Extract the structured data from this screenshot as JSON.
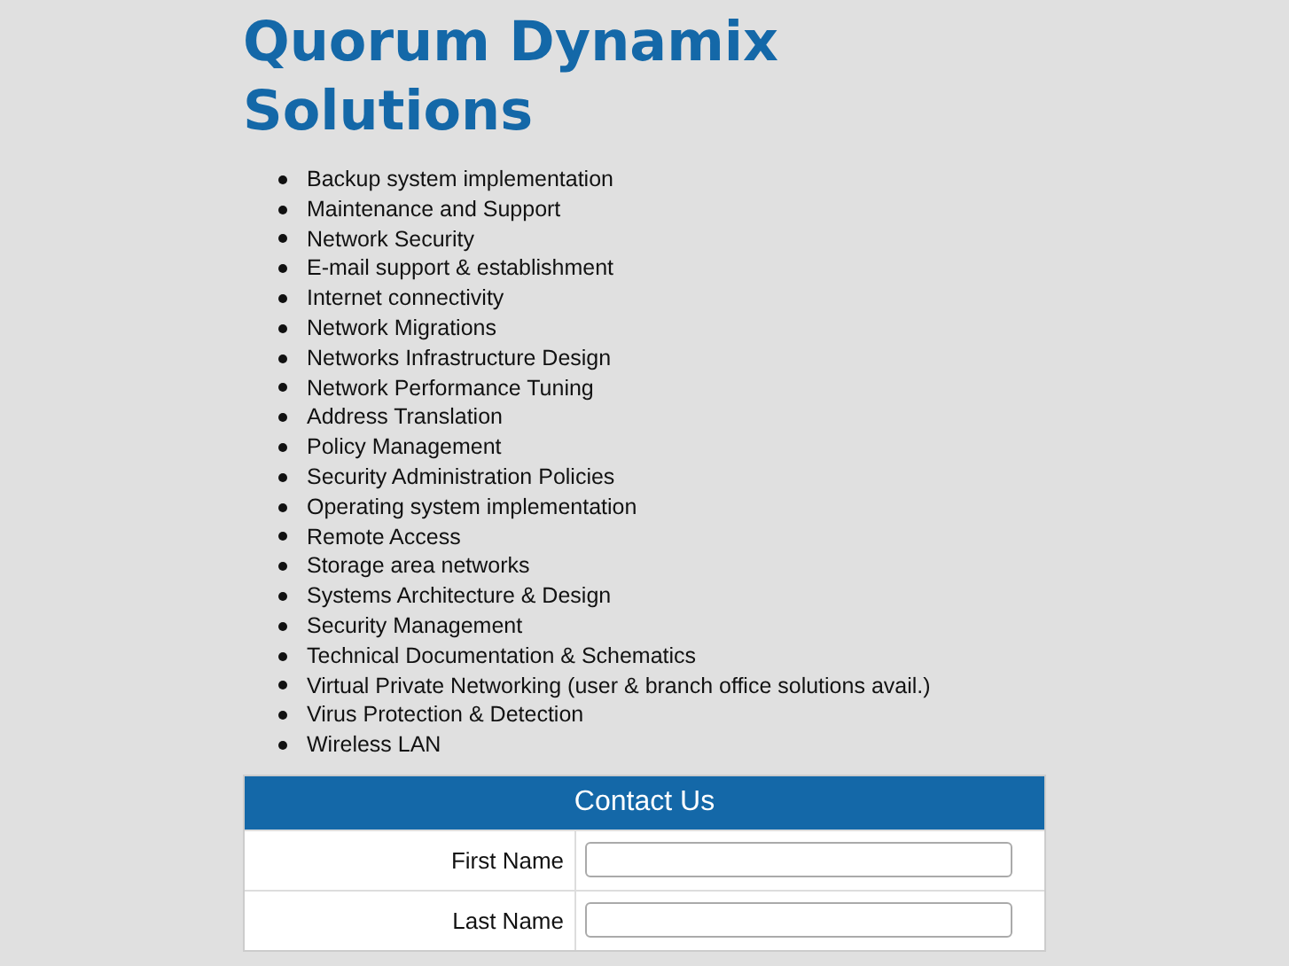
{
  "title": "Quorum Dynamix Solutions",
  "services": [
    "Backup system implementation",
    "Maintenance and Support",
    "Network Security",
    "E-mail support & establishment",
    "Internet connectivity",
    "Network Migrations",
    "Networks Infrastructure Design",
    "Network Performance Tuning",
    "Address Translation",
    "Policy Management",
    "Security Administration Policies",
    "Operating system implementation",
    "Remote Access",
    "Storage area networks",
    "Systems Architecture & Design",
    "Security Management",
    "Technical Documentation & Schematics",
    "Virtual Private Networking (user & branch office solutions avail.)",
    "Virus Protection & Detection",
    "Wireless LAN"
  ],
  "contact_form": {
    "title": "Contact Us",
    "fields": [
      {
        "label": "First Name"
      },
      {
        "label": "Last Name"
      }
    ]
  }
}
